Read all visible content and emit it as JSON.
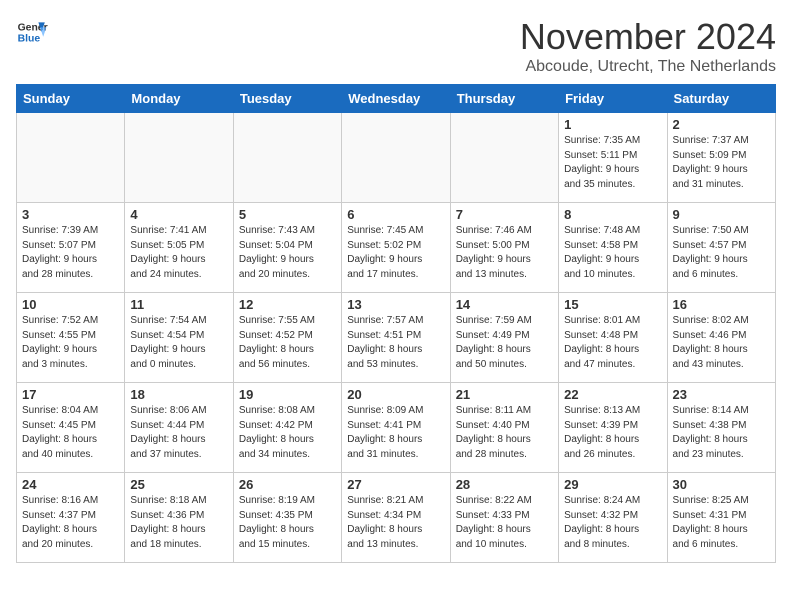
{
  "header": {
    "logo_line1": "General",
    "logo_line2": "Blue",
    "month_year": "November 2024",
    "location": "Abcoude, Utrecht, The Netherlands"
  },
  "weekdays": [
    "Sunday",
    "Monday",
    "Tuesday",
    "Wednesday",
    "Thursday",
    "Friday",
    "Saturday"
  ],
  "weeks": [
    [
      {
        "day": "",
        "info": ""
      },
      {
        "day": "",
        "info": ""
      },
      {
        "day": "",
        "info": ""
      },
      {
        "day": "",
        "info": ""
      },
      {
        "day": "",
        "info": ""
      },
      {
        "day": "1",
        "info": "Sunrise: 7:35 AM\nSunset: 5:11 PM\nDaylight: 9 hours\nand 35 minutes."
      },
      {
        "day": "2",
        "info": "Sunrise: 7:37 AM\nSunset: 5:09 PM\nDaylight: 9 hours\nand 31 minutes."
      }
    ],
    [
      {
        "day": "3",
        "info": "Sunrise: 7:39 AM\nSunset: 5:07 PM\nDaylight: 9 hours\nand 28 minutes."
      },
      {
        "day": "4",
        "info": "Sunrise: 7:41 AM\nSunset: 5:05 PM\nDaylight: 9 hours\nand 24 minutes."
      },
      {
        "day": "5",
        "info": "Sunrise: 7:43 AM\nSunset: 5:04 PM\nDaylight: 9 hours\nand 20 minutes."
      },
      {
        "day": "6",
        "info": "Sunrise: 7:45 AM\nSunset: 5:02 PM\nDaylight: 9 hours\nand 17 minutes."
      },
      {
        "day": "7",
        "info": "Sunrise: 7:46 AM\nSunset: 5:00 PM\nDaylight: 9 hours\nand 13 minutes."
      },
      {
        "day": "8",
        "info": "Sunrise: 7:48 AM\nSunset: 4:58 PM\nDaylight: 9 hours\nand 10 minutes."
      },
      {
        "day": "9",
        "info": "Sunrise: 7:50 AM\nSunset: 4:57 PM\nDaylight: 9 hours\nand 6 minutes."
      }
    ],
    [
      {
        "day": "10",
        "info": "Sunrise: 7:52 AM\nSunset: 4:55 PM\nDaylight: 9 hours\nand 3 minutes."
      },
      {
        "day": "11",
        "info": "Sunrise: 7:54 AM\nSunset: 4:54 PM\nDaylight: 9 hours\nand 0 minutes."
      },
      {
        "day": "12",
        "info": "Sunrise: 7:55 AM\nSunset: 4:52 PM\nDaylight: 8 hours\nand 56 minutes."
      },
      {
        "day": "13",
        "info": "Sunrise: 7:57 AM\nSunset: 4:51 PM\nDaylight: 8 hours\nand 53 minutes."
      },
      {
        "day": "14",
        "info": "Sunrise: 7:59 AM\nSunset: 4:49 PM\nDaylight: 8 hours\nand 50 minutes."
      },
      {
        "day": "15",
        "info": "Sunrise: 8:01 AM\nSunset: 4:48 PM\nDaylight: 8 hours\nand 47 minutes."
      },
      {
        "day": "16",
        "info": "Sunrise: 8:02 AM\nSunset: 4:46 PM\nDaylight: 8 hours\nand 43 minutes."
      }
    ],
    [
      {
        "day": "17",
        "info": "Sunrise: 8:04 AM\nSunset: 4:45 PM\nDaylight: 8 hours\nand 40 minutes."
      },
      {
        "day": "18",
        "info": "Sunrise: 8:06 AM\nSunset: 4:44 PM\nDaylight: 8 hours\nand 37 minutes."
      },
      {
        "day": "19",
        "info": "Sunrise: 8:08 AM\nSunset: 4:42 PM\nDaylight: 8 hours\nand 34 minutes."
      },
      {
        "day": "20",
        "info": "Sunrise: 8:09 AM\nSunset: 4:41 PM\nDaylight: 8 hours\nand 31 minutes."
      },
      {
        "day": "21",
        "info": "Sunrise: 8:11 AM\nSunset: 4:40 PM\nDaylight: 8 hours\nand 28 minutes."
      },
      {
        "day": "22",
        "info": "Sunrise: 8:13 AM\nSunset: 4:39 PM\nDaylight: 8 hours\nand 26 minutes."
      },
      {
        "day": "23",
        "info": "Sunrise: 8:14 AM\nSunset: 4:38 PM\nDaylight: 8 hours\nand 23 minutes."
      }
    ],
    [
      {
        "day": "24",
        "info": "Sunrise: 8:16 AM\nSunset: 4:37 PM\nDaylight: 8 hours\nand 20 minutes."
      },
      {
        "day": "25",
        "info": "Sunrise: 8:18 AM\nSunset: 4:36 PM\nDaylight: 8 hours\nand 18 minutes."
      },
      {
        "day": "26",
        "info": "Sunrise: 8:19 AM\nSunset: 4:35 PM\nDaylight: 8 hours\nand 15 minutes."
      },
      {
        "day": "27",
        "info": "Sunrise: 8:21 AM\nSunset: 4:34 PM\nDaylight: 8 hours\nand 13 minutes."
      },
      {
        "day": "28",
        "info": "Sunrise: 8:22 AM\nSunset: 4:33 PM\nDaylight: 8 hours\nand 10 minutes."
      },
      {
        "day": "29",
        "info": "Sunrise: 8:24 AM\nSunset: 4:32 PM\nDaylight: 8 hours\nand 8 minutes."
      },
      {
        "day": "30",
        "info": "Sunrise: 8:25 AM\nSunset: 4:31 PM\nDaylight: 8 hours\nand 6 minutes."
      }
    ]
  ]
}
